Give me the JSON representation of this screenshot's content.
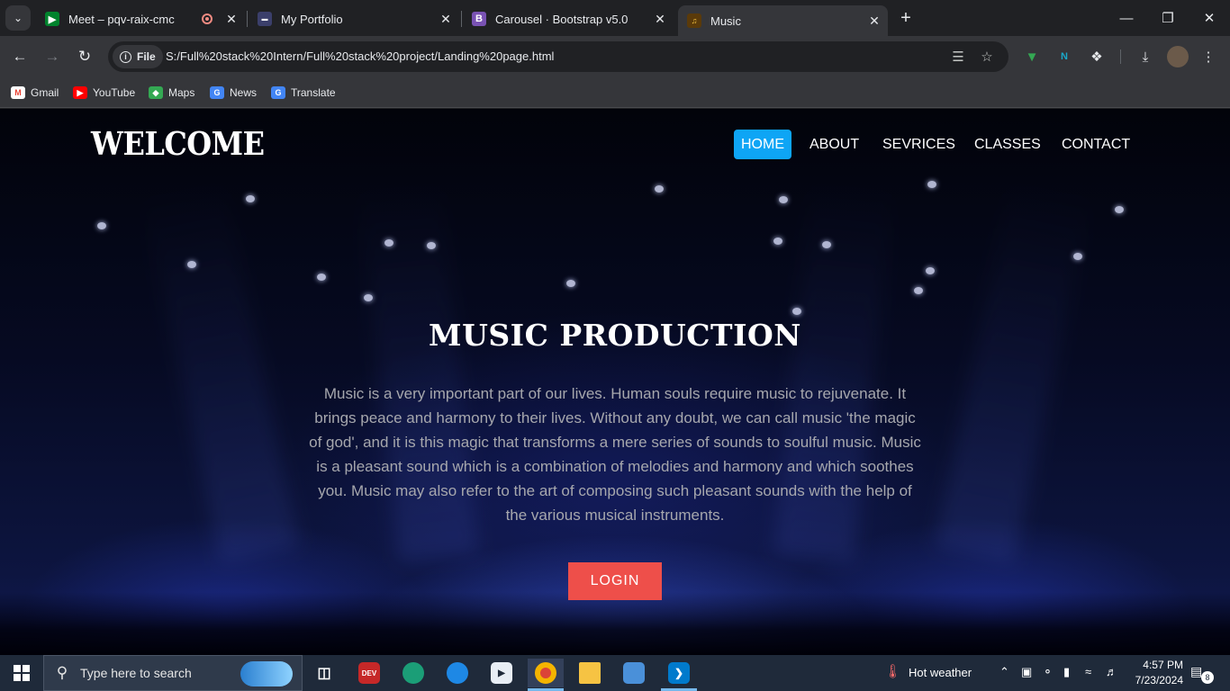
{
  "browser": {
    "tabs": [
      {
        "title": "Meet – pqv-raix-cmc",
        "favicon": "google-meet-icon",
        "recording": true
      },
      {
        "title": "My Portfolio",
        "favicon": "portfolio-icon"
      },
      {
        "title": "Carousel · Bootstrap v5.0",
        "favicon": "bootstrap-icon",
        "favicon_letter": "B"
      },
      {
        "title": "Music",
        "favicon": "music-icon",
        "active": true
      }
    ],
    "address": {
      "chip_label": "File",
      "url": "S:/Full%20stack%20Intern/Full%20stack%20project/Landing%20page.html"
    },
    "bookmarks": [
      {
        "label": "Gmail",
        "icon": "gmail-icon",
        "color": "#ea4335",
        "glyph": "M"
      },
      {
        "label": "YouTube",
        "icon": "youtube-icon",
        "color": "#ff0000",
        "glyph": "▶"
      },
      {
        "label": "Maps",
        "icon": "maps-icon",
        "color": "#34a853",
        "glyph": "◆"
      },
      {
        "label": "News",
        "icon": "news-icon",
        "color": "#4285f4",
        "glyph": "G"
      },
      {
        "label": "Translate",
        "icon": "translate-icon",
        "color": "#4285f4",
        "glyph": "G"
      }
    ]
  },
  "page": {
    "logo": "WELCOME",
    "nav": [
      {
        "label": "HOME",
        "active": true
      },
      {
        "label": "ABOUT"
      },
      {
        "label": "SEVRICES"
      },
      {
        "label": "CLASSES"
      },
      {
        "label": "CONTACT"
      }
    ],
    "hero": {
      "title": "MUSIC PRODUCTION",
      "text": "Music is a very important part of our lives. Human souls require music to rejuvenate. It brings peace and harmony to their lives. Without any doubt, we can call music 'the magic of god', and it is this magic that transforms a mere series of sounds to soulful music. Music is a pleasant sound which is a combination of melodies and harmony and which soothes you. Music may also refer to the art of composing such pleasant sounds with the help of the various musical instruments.",
      "button": "LOGIN"
    },
    "colors": {
      "accent": "#0ea5f5",
      "button": "#ee4f4a"
    }
  },
  "taskbar": {
    "search_placeholder": "Type here to search",
    "apps": [
      "task-view-icon",
      "devcpp-icon",
      "edge-dev-icon",
      "edge-icon",
      "media-player-icon",
      "chrome-icon",
      "file-explorer-icon",
      "app-icon",
      "vscode-icon"
    ],
    "weather": "Hot weather",
    "time": "4:57 PM",
    "date": "7/23/2024",
    "notifications": "8"
  }
}
